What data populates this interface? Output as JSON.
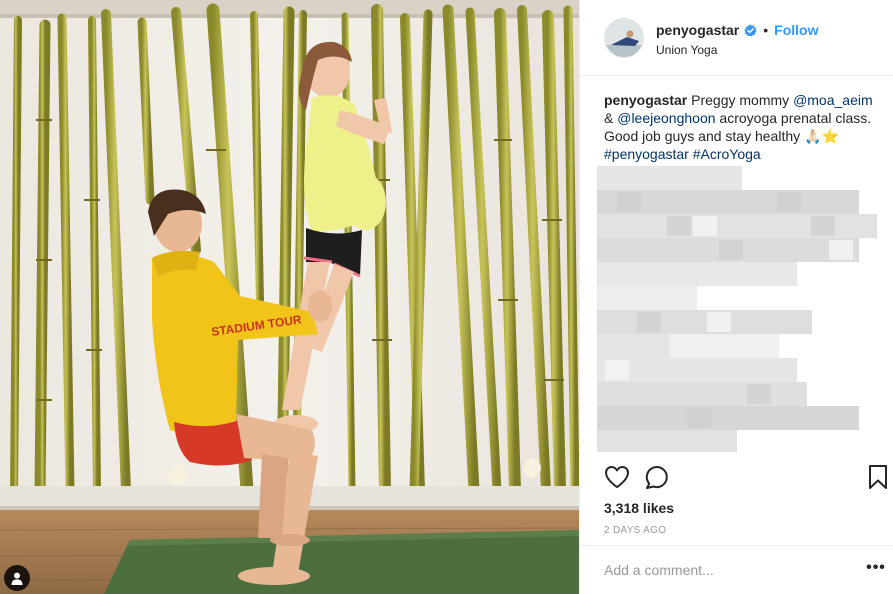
{
  "photo": {
    "jacket_text": "STADIUM TOUR",
    "tag_button_icon": "user-tag-icon"
  },
  "post": {
    "username": "penyogastar",
    "verified_icon": "verified-badge-icon",
    "separator": "•",
    "follow_label": "Follow",
    "location": "Union Yoga",
    "caption": {
      "author": "penyogastar",
      "text_1": " Preggy mommy ",
      "mention_1": "@moa_aeim",
      "text_2": " & ",
      "mention_2": "@leejeonghoon",
      "text_3": " acroyoga prenatal class. Good job guys and stay healthy ",
      "emoji": "🙏🏻⭐",
      "hashtag_1": "#penyogastar",
      "hashtag_2": "#AcroYoga"
    },
    "likes": "3,318 likes",
    "time_ago": "2 DAYS AGO",
    "comment_placeholder": "Add a comment...",
    "more_label": "•••"
  },
  "icons": {
    "like": "heart-icon",
    "comment": "comment-icon",
    "save": "bookmark-icon",
    "more": "more-options-icon"
  },
  "colors": {
    "accent": "#3897f0",
    "link": "#003569",
    "muted": "#999999",
    "border": "#efefef"
  }
}
